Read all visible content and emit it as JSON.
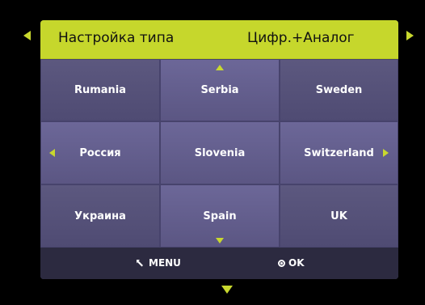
{
  "header": {
    "label": "Настройка типа",
    "value": "Цифр.+Аналог"
  },
  "grid": {
    "rows": [
      [
        "Rumania",
        "Serbia",
        "Sweden"
      ],
      [
        "Россия",
        "Slovenia",
        "Switzerland"
      ],
      [
        "Украина",
        "Spain",
        "UK"
      ]
    ]
  },
  "footer": {
    "menu_label": "MENU",
    "ok_label": "OK"
  },
  "colors": {
    "accent": "#c6d72c",
    "panel": "#5f5a86",
    "footer": "#2c2a40"
  },
  "icons": {
    "nav_left": "triangle-left-icon",
    "nav_right": "triangle-right-icon",
    "nav_down": "triangle-down-icon",
    "menu": "return-arrow-icon",
    "ok": "ring-icon"
  }
}
